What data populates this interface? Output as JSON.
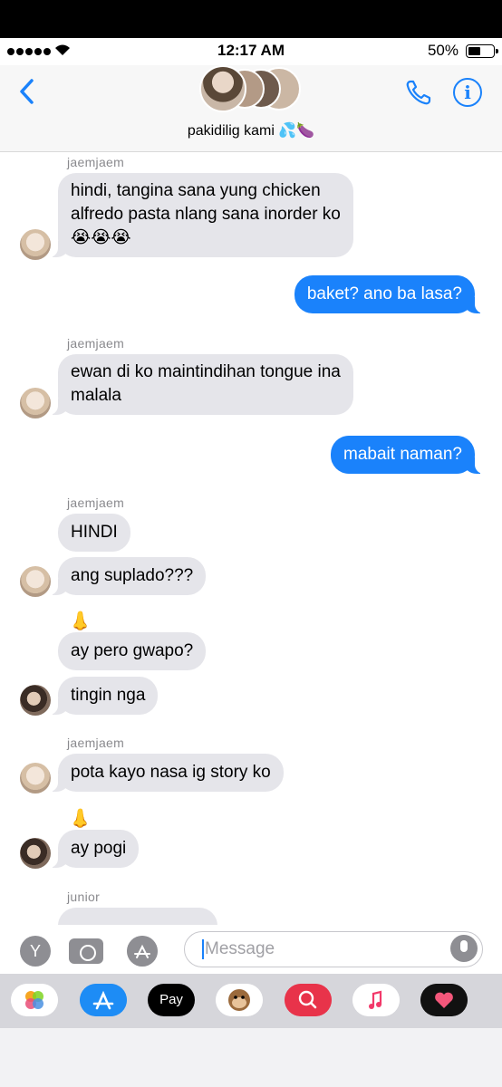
{
  "status_bar": {
    "time": "12:17 AM",
    "battery": "50%"
  },
  "header": {
    "group_name": "pakidilig kami 💦🍆",
    "back_icon": "chevron-left-icon",
    "call_icon": "phone-icon",
    "info_icon": "info-icon",
    "info_label": "i"
  },
  "messages": [
    {
      "sender": "jaemjaem",
      "lines": [
        "hindi, tangina sana yung chicken",
        "alfredo pasta nlang sana inorder ko",
        "😭😭😭"
      ]
    },
    {
      "out": "baket? ano ba lasa?"
    },
    {
      "sender": "jaemjaem",
      "lines": [
        "ewan di ko maintindihan tongue ina",
        "malala"
      ]
    },
    {
      "out": "mabait naman?"
    },
    {
      "sender": "jaemjaem",
      "lines": [
        "HINDI",
        "ang suplado???"
      ]
    },
    {
      "emoji": "👃",
      "lines": [
        "ay pero gwapo?",
        "tingin nga"
      ]
    },
    {
      "sender": "jaemjaem",
      "lines": [
        "pota kayo nasa ig story ko"
      ]
    },
    {
      "emoji": "👃",
      "lines": [
        "ay pogi"
      ]
    },
    {
      "sender": "junior"
    }
  ],
  "compose": {
    "placeholder": "Message",
    "y_label": "Y"
  },
  "apps": {
    "pay_label": "Pay"
  }
}
